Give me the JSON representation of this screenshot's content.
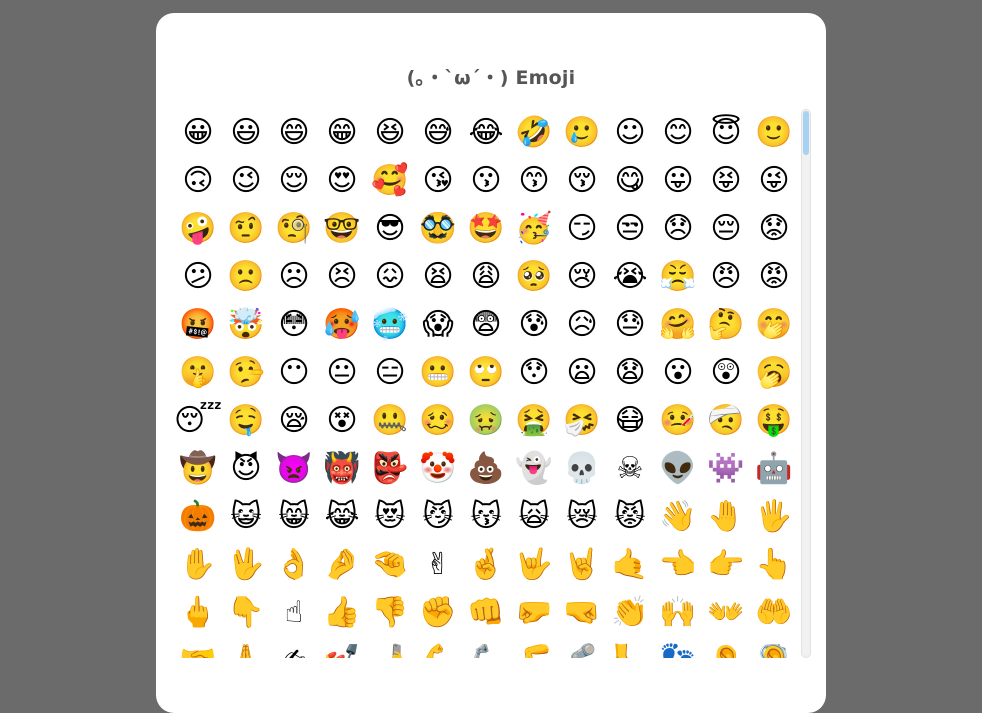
{
  "picker": {
    "title": "(｡・`ω´・) Emoji",
    "emojis": [
      "😀",
      "😃",
      "😄",
      "😁",
      "😆",
      "😅",
      "😂",
      "🤣",
      "🥲",
      "☺",
      "😊",
      "😇",
      "🙂",
      "🙃",
      "😉",
      "😌",
      "😍",
      "🥰",
      "😘",
      "😗",
      "😙",
      "😚",
      "😋",
      "😛",
      "😝",
      "😜",
      "🤪",
      "🤨",
      "🧐",
      "🤓",
      "😎",
      "🥸",
      "🤩",
      "🥳",
      "😏",
      "😒",
      "😞",
      "😔",
      "😟",
      "😕",
      "🙁",
      "☹",
      "😣",
      "😖",
      "😫",
      "😩",
      "🥺",
      "😢",
      "😭",
      "😤",
      "😠",
      "😡",
      "🤬",
      "🤯",
      "😳",
      "🥵",
      "🥶",
      "😱",
      "😨",
      "😰",
      "😥",
      "😓",
      "🤗",
      "🤔",
      "🤭",
      "🤫",
      "🤥",
      "😶",
      "😐",
      "😑",
      "😬",
      "🙄",
      "😯",
      "😦",
      "😧",
      "😮",
      "😲",
      "🥱",
      "😴",
      "🤤",
      "😪",
      "😵",
      "🤐",
      "🥴",
      "🤢",
      "🤮",
      "🤧",
      "😷",
      "🤒",
      "🤕",
      "🤑",
      "🤠",
      "😈",
      "👿",
      "👹",
      "👺",
      "🤡",
      "💩",
      "👻",
      "💀",
      "☠",
      "👽",
      "👾",
      "🤖",
      "🎃",
      "😺",
      "😸",
      "😹",
      "😻",
      "😼",
      "😽",
      "🙀",
      "😿",
      "😾",
      "👋",
      "🤚",
      "🖐",
      "✋",
      "🖖",
      "👌",
      "🤌",
      "🤏",
      "✌",
      "🤞",
      "🤟",
      "🤘",
      "🤙",
      "👈",
      "👉",
      "👆",
      "🖕",
      "👇",
      "☝",
      "👍",
      "👎",
      "✊",
      "👊",
      "🤛",
      "🤜",
      "👏",
      "🙌",
      "👐",
      "🤲",
      "🤝",
      "🙏",
      "✍",
      "💅",
      "🤳",
      "💪",
      "🦾",
      "🦵",
      "🦿",
      "🦶",
      "👣",
      "👂",
      "🦻"
    ]
  },
  "scrollbar": {
    "scroll_position": 0.0
  }
}
